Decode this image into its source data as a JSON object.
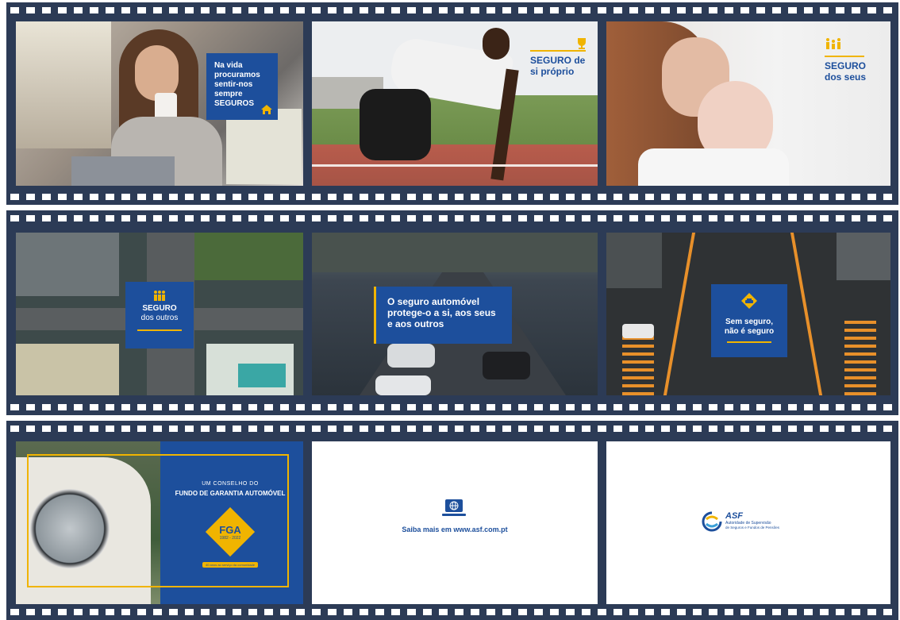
{
  "strip1": {
    "frame1": {
      "text": "Na vida procuramos sentir-nos sempre SEGUROS",
      "icon": "house-icon"
    },
    "frame2": {
      "line1": "SEGURO de",
      "line2": "si próprio",
      "icon": "trophy-icon"
    },
    "frame3": {
      "line1": "SEGURO",
      "line2": "dos seus",
      "icon": "family-icon"
    }
  },
  "strip2": {
    "frame1": {
      "line1": "SEGURO",
      "line2": "dos outros",
      "icon": "people-icon"
    },
    "frame2": {
      "line1": "O seguro automóvel",
      "line2": "protege-o a si, aos seus",
      "line3": "e aos outros"
    },
    "frame3": {
      "line1": "Sem seguro,",
      "line2": "não é seguro",
      "icon": "car-warning-icon"
    }
  },
  "strip3": {
    "frame1": {
      "small": "UM CONSELHO DO",
      "title": "FUNDO DE GARANTIA AUTOMÓVEL",
      "badge": "FGA",
      "years": "1982 - 2022",
      "ribbon": "40 anos ao serviço da comunidade"
    },
    "frame2": {
      "text": "Saiba mais em www.asf.com.pt",
      "icon": "laptop-globe-icon"
    },
    "frame3": {
      "brand": "ASF",
      "line1": "Autoridade de Supervisão",
      "line2": "de Seguros e Fundos de Pensões",
      "icon": "asf-logo-icon"
    }
  }
}
